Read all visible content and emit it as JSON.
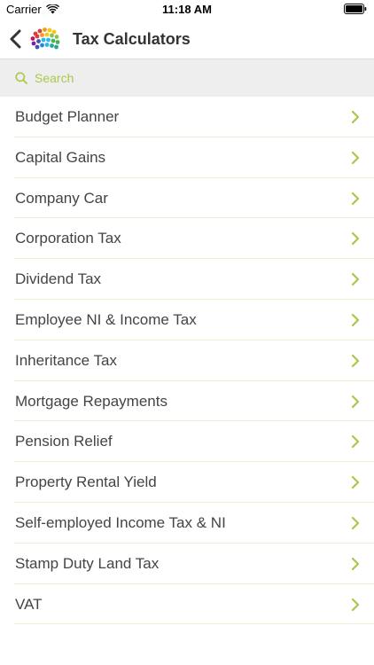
{
  "status_bar": {
    "carrier": "Carrier",
    "time": "11:18 AM"
  },
  "nav": {
    "title": "Tax Calculators"
  },
  "search": {
    "placeholder": "Search"
  },
  "list": {
    "items": [
      {
        "label": "Budget Planner"
      },
      {
        "label": "Capital Gains"
      },
      {
        "label": "Company Car"
      },
      {
        "label": "Corporation Tax"
      },
      {
        "label": "Dividend Tax"
      },
      {
        "label": "Employee NI & Income Tax"
      },
      {
        "label": "Inheritance Tax"
      },
      {
        "label": "Mortgage Repayments"
      },
      {
        "label": "Pension Relief"
      },
      {
        "label": "Property Rental Yield"
      },
      {
        "label": "Self-employed Income Tax & NI"
      },
      {
        "label": "Stamp Duty Land Tax"
      },
      {
        "label": "VAT"
      }
    ]
  },
  "colors": {
    "accent": "#a9c94a",
    "text": "#444444",
    "search_bg": "#eeeeee"
  },
  "icons": {
    "back": "chevron-left-icon",
    "logo": "app-logo",
    "search": "search-icon",
    "row": "chevron-right-icon",
    "wifi": "wifi-icon",
    "battery": "battery-icon"
  }
}
